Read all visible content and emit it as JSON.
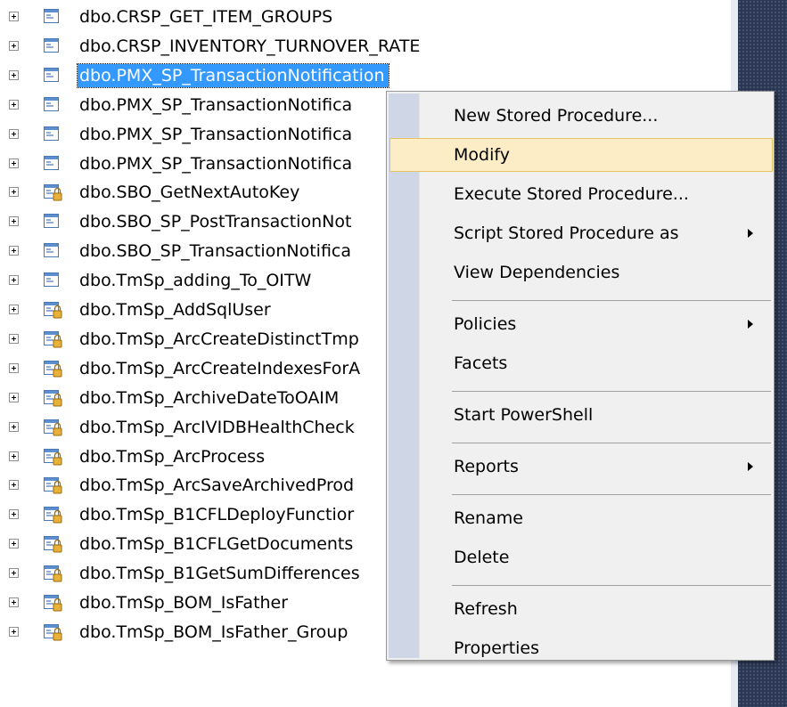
{
  "tree": {
    "items": [
      {
        "label": "dbo.CRSP_GET_ITEM_GROUPS",
        "icon": "stored-procedure-icon"
      },
      {
        "label": "dbo.CRSP_INVENTORY_TURNOVER_RATE",
        "icon": "stored-procedure-icon"
      },
      {
        "label": "dbo.PMX_SP_TransactionNotification",
        "icon": "stored-procedure-icon",
        "selected": true
      },
      {
        "label": "dbo.PMX_SP_TransactionNotifica",
        "icon": "stored-procedure-icon"
      },
      {
        "label": "dbo.PMX_SP_TransactionNotifica",
        "icon": "stored-procedure-icon"
      },
      {
        "label": "dbo.PMX_SP_TransactionNotifica",
        "icon": "stored-procedure-icon"
      },
      {
        "label": "dbo.SBO_GetNextAutoKey",
        "icon": "locked-stored-procedure-icon"
      },
      {
        "label": "dbo.SBO_SP_PostTransactionNot",
        "icon": "stored-procedure-icon"
      },
      {
        "label": "dbo.SBO_SP_TransactionNotifica",
        "icon": "stored-procedure-icon"
      },
      {
        "label": "dbo.TmSp_adding_To_OITW",
        "icon": "stored-procedure-icon"
      },
      {
        "label": "dbo.TmSp_AddSqlUser",
        "icon": "locked-stored-procedure-icon"
      },
      {
        "label": "dbo.TmSp_ArcCreateDistinctTmp",
        "icon": "locked-stored-procedure-icon"
      },
      {
        "label": "dbo.TmSp_ArcCreateIndexesForA",
        "icon": "locked-stored-procedure-icon"
      },
      {
        "label": "dbo.TmSp_ArchiveDateToOAIM",
        "icon": "locked-stored-procedure-icon"
      },
      {
        "label": "dbo.TmSp_ArcIVIDBHealthCheck",
        "icon": "locked-stored-procedure-icon"
      },
      {
        "label": "dbo.TmSp_ArcProcess",
        "icon": "locked-stored-procedure-icon"
      },
      {
        "label": "dbo.TmSp_ArcSaveArchivedProd",
        "icon": "locked-stored-procedure-icon"
      },
      {
        "label": "dbo.TmSp_B1CFLDeployFunctior",
        "icon": "locked-stored-procedure-icon"
      },
      {
        "label": "dbo.TmSp_B1CFLGetDocuments",
        "icon": "locked-stored-procedure-icon"
      },
      {
        "label": "dbo.TmSp_B1GetSumDifferences",
        "icon": "locked-stored-procedure-icon"
      },
      {
        "label": "dbo.TmSp_BOM_IsFather",
        "icon": "locked-stored-procedure-icon"
      },
      {
        "label": "dbo.TmSp_BOM_IsFather_Group",
        "icon": "locked-stored-procedure-icon"
      }
    ]
  },
  "context_menu": {
    "items": [
      {
        "label": "New Stored Procedure..."
      },
      {
        "label": "Modify",
        "highlighted": true
      },
      {
        "label": "Execute Stored Procedure..."
      },
      {
        "label": "Script Stored Procedure as",
        "submenu": true
      },
      {
        "label": "View Dependencies"
      },
      {
        "separator": true
      },
      {
        "label": "Policies",
        "submenu": true
      },
      {
        "label": "Facets"
      },
      {
        "separator": true
      },
      {
        "label": "Start PowerShell"
      },
      {
        "separator": true
      },
      {
        "label": "Reports",
        "submenu": true
      },
      {
        "separator": true
      },
      {
        "label": "Rename"
      },
      {
        "label": "Delete"
      },
      {
        "separator": true
      },
      {
        "label": "Refresh"
      },
      {
        "label": "Properties"
      }
    ]
  },
  "colors": {
    "selection": "#3399ff",
    "menu_hover": "#fcedc6",
    "menu_hover_border": "#e5c365",
    "menu_gutter": "#cfd6e5",
    "side_panel": "#2b3752"
  }
}
